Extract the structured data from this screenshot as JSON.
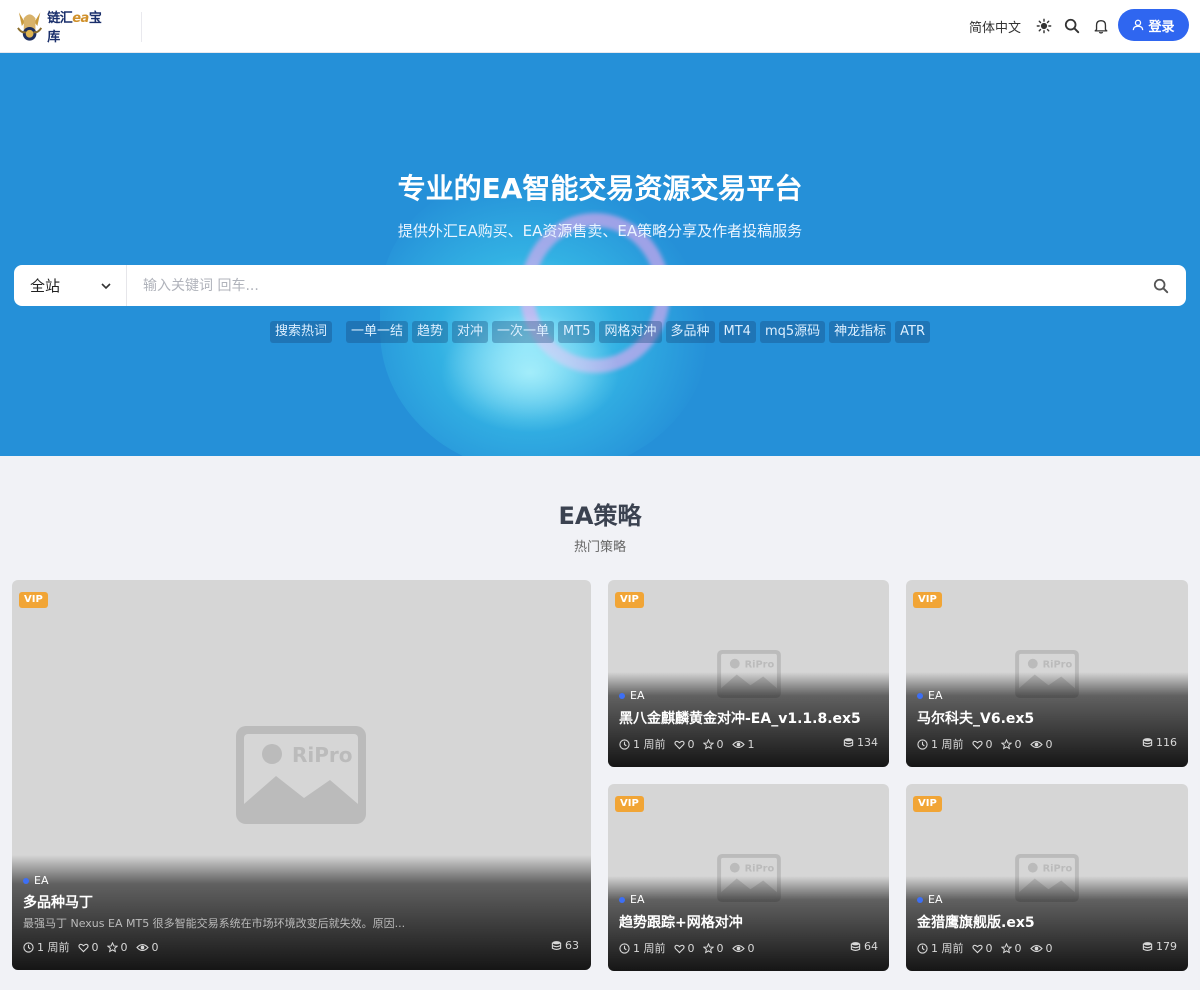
{
  "header": {
    "logo_main": "链汇",
    "logo_ea": "ea",
    "logo_tail": "宝库",
    "language": "简体中文",
    "login_label": "登录"
  },
  "hero": {
    "title": "专业的EA智能交易资源交易平台",
    "subtitle": "提供外汇EA购买、EA资源售卖、EA策略分享及作者投稿服务",
    "search_scope": "全站",
    "search_placeholder": "输入关键词 回车...",
    "hot_label": "搜索热词",
    "hot_tags": [
      "一单一结",
      "趋势",
      "对冲",
      "一次一单",
      "MT5",
      "网格对冲",
      "多品种",
      "MT4",
      "mq5源码",
      "神龙指标",
      "ATR"
    ]
  },
  "section": {
    "title": "EA策略",
    "subtitle": "热门策略"
  },
  "cards": [
    {
      "badge": "VIP",
      "category": "EA",
      "title": "多品种马丁",
      "desc": "最强马丁 Nexus EA MT5 很多智能交易系统在市场环境改变后就失效。原因...",
      "time": "1 周前",
      "likes": "0",
      "favs": "0",
      "views": "0",
      "downloads": "63"
    },
    {
      "badge": "VIP",
      "category": "EA",
      "title": "黑八金麒麟黄金对冲-EA_v1.1.8.ex5",
      "time": "1 周前",
      "likes": "0",
      "favs": "0",
      "views": "1",
      "downloads": "134"
    },
    {
      "badge": "VIP",
      "category": "EA",
      "title": "马尔科夫_V6.ex5",
      "time": "1 周前",
      "likes": "0",
      "favs": "0",
      "views": "0",
      "downloads": "116"
    },
    {
      "badge": "VIP",
      "category": "EA",
      "title": "趋势跟踪+网格对冲",
      "time": "1 周前",
      "likes": "0",
      "favs": "0",
      "views": "0",
      "downloads": "64"
    },
    {
      "badge": "VIP",
      "category": "EA",
      "title": "金猎鹰旗舰版.ex5",
      "time": "1 周前",
      "likes": "0",
      "favs": "0",
      "views": "0",
      "downloads": "179"
    }
  ],
  "placeholder_brand": "RiPro",
  "icons": {
    "theme": "sun-icon",
    "search": "search-icon",
    "bell": "bell-icon",
    "user": "user-icon",
    "chevron": "chevron-down-icon",
    "clock": "clock-icon",
    "heart": "heart-icon",
    "star": "star-icon",
    "eye": "eye-icon",
    "coins": "coins-icon"
  },
  "colors": {
    "accent": "#2f66f0",
    "hero_bg": "#2590d8",
    "vip": "#f1a536",
    "category_dot": "#3d6ff5"
  }
}
